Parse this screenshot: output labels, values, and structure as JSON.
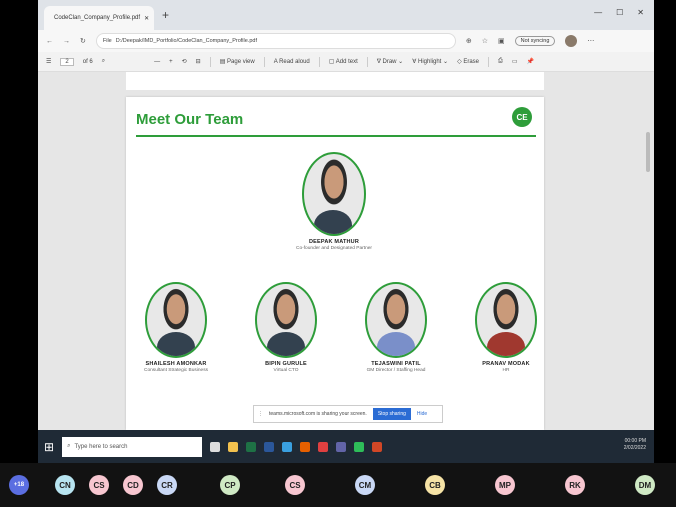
{
  "browser": {
    "tab_title": "CodeClan_Company_Profile.pdf",
    "url_prefix": "File",
    "url": "D:/Deepak/IMD_Portfolio/CodeClan_Company_Profile.pdf",
    "signin_label": "Not syncing"
  },
  "pdf_toolbar": {
    "page_number": "2",
    "page_total": "of 6",
    "page_view": "Page view",
    "read_aloud": "Read aloud",
    "add_text": "Add text",
    "draw": "Draw",
    "highlight": "Highlight",
    "erase": "Erase"
  },
  "page": {
    "title": "Meet Our Team",
    "logo_text": "CE"
  },
  "team": [
    {
      "name": "DEEPAK MATHUR",
      "role": "Co-founder and Designated Partner"
    },
    {
      "name": "SHAILESH AMONKAR",
      "role": "Consultant Strategic Business"
    },
    {
      "name": "BIPIN GURULE",
      "role": "Virtual CTO"
    },
    {
      "name": "TEJASWINI PATIL",
      "role": "GM Director / Staffing Head"
    },
    {
      "name": "PRANAV MODAK",
      "role": "HR"
    }
  ],
  "share_bar": {
    "message": "teams.microsoft.com is sharing your screen.",
    "stop_label": "Stop sharing",
    "hide_label": "Hide"
  },
  "taskbar": {
    "search_placeholder": "Type here to search",
    "time": "00:00 PM",
    "date": "2/02/2022"
  },
  "participants": [
    {
      "initials": "+18",
      "color": "#5b6ee1"
    },
    {
      "initials": "CN",
      "color": "#b7e4f0"
    },
    {
      "initials": "CS",
      "color": "#f7c6d0"
    },
    {
      "initials": "CD",
      "color": "#f7c6d0"
    },
    {
      "initials": "CR",
      "color": "#c9d8f5"
    },
    {
      "initials": "CP",
      "color": "#cfe9c4"
    },
    {
      "initials": "CS",
      "color": "#f7c6d0"
    },
    {
      "initials": "CM",
      "color": "#c9d8f5"
    },
    {
      "initials": "CB",
      "color": "#f6e3a6"
    },
    {
      "initials": "MP",
      "color": "#f7c6d0"
    },
    {
      "initials": "RK",
      "color": "#f7c6d0"
    },
    {
      "initials": "DM",
      "color": "#cfe9c4"
    }
  ]
}
